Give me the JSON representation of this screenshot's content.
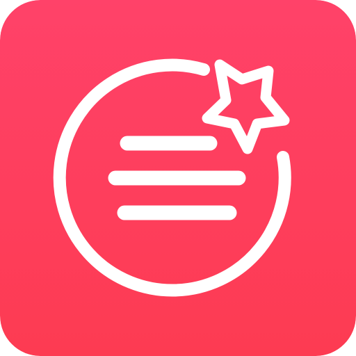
{
  "app_icon": {
    "name": "list-with-star-icon",
    "colors": {
      "background_top": "#ff4269",
      "background_bottom": "#fd3b52",
      "foreground": "#ffffff"
    },
    "list_line_count": 3
  }
}
